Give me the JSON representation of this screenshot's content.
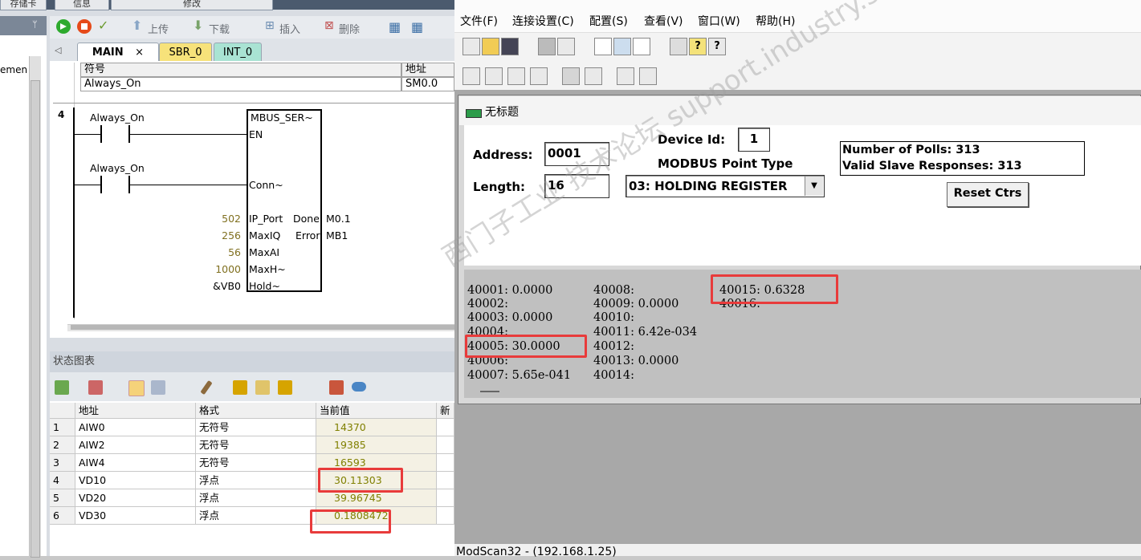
{
  "left_app": {
    "top_tabs": [
      "存储卡",
      "信息",
      "修改"
    ],
    "sidebar_text": "emen",
    "toolbar": {
      "upload_label": "上传",
      "download_label": "下载",
      "insert_label": "插入",
      "delete_label": "删除"
    },
    "tabs": [
      {
        "label": "MAIN",
        "close": "×"
      },
      {
        "label": "SBR_0"
      },
      {
        "label": "INT_0"
      }
    ],
    "symbol_table": {
      "headers": {
        "symbol": "符号",
        "address": "地址"
      },
      "row": {
        "symbol": "Always_On",
        "address": "SM0.0"
      }
    },
    "network": {
      "number": "4",
      "contact1": "Always_On",
      "contact2": "Always_On",
      "block_name": "MBUS_SER~",
      "pins": {
        "en": "EN",
        "conn": "Conn~",
        "ip_port": "IP_Port",
        "maxiq": "MaxIQ",
        "maxai": "MaxAI",
        "maxh": "MaxH~",
        "hold": "Hold~",
        "done": "Done",
        "error": "Error"
      },
      "inputs": {
        "ip_port": "502",
        "maxiq": "256",
        "maxai": "56",
        "maxh": "1000",
        "hold": "&VB0"
      },
      "outputs": {
        "done": "M0.1",
        "error": "MB1"
      }
    },
    "status_chart": {
      "title": "状态图表",
      "headers": {
        "address": "地址",
        "format": "格式",
        "current": "当前值",
        "new": "新"
      },
      "rows": [
        {
          "n": "1",
          "address": "AIW0",
          "format": "无符号",
          "value": "14370"
        },
        {
          "n": "2",
          "address": "AIW2",
          "format": "无符号",
          "value": "19385"
        },
        {
          "n": "3",
          "address": "AIW4",
          "format": "无符号",
          "value": "16593"
        },
        {
          "n": "4",
          "address": "VD10",
          "format": "浮点",
          "value": "30.11303"
        },
        {
          "n": "5",
          "address": "VD20",
          "format": "浮点",
          "value": "39.96745"
        },
        {
          "n": "6",
          "address": "VD30",
          "format": "浮点",
          "value": "0.1808472"
        }
      ]
    }
  },
  "modscan": {
    "menu": [
      "文件(F)",
      "连接设置(C)",
      "配置(S)",
      "查看(V)",
      "窗口(W)",
      "帮助(H)"
    ],
    "child_title": "无标题",
    "address_label": "Address:",
    "address_value": "0001",
    "length_label": "Length:",
    "length_value": "16",
    "device_id_label": "Device Id:",
    "device_id_value": "1",
    "point_type_label": "MODBUS Point Type",
    "point_type_value": "03: HOLDING REGISTER",
    "polls": "Number of Polls: 313",
    "valid": "Valid Slave Responses: 313",
    "reset_label": "Reset Ctrs",
    "data_col1": [
      "40001:  0.0000",
      "40002:",
      "40003:  0.0000",
      "40004:",
      "40005:  30.0000",
      "40006:",
      "40007:  5.65e-041"
    ],
    "data_col2": [
      "40008:",
      "40009:  0.0000",
      "40010:",
      "40011:  6.42e-034",
      "40012:",
      "40013:  0.0000",
      "40014:"
    ],
    "data_col3": [
      "40015:  0.6328",
      "40016:"
    ],
    "statusbar": "ModScan32 - (192.168.1.25)",
    "watermark": "西门子工业 技术论坛 support.industry.siemens.com/cs"
  }
}
